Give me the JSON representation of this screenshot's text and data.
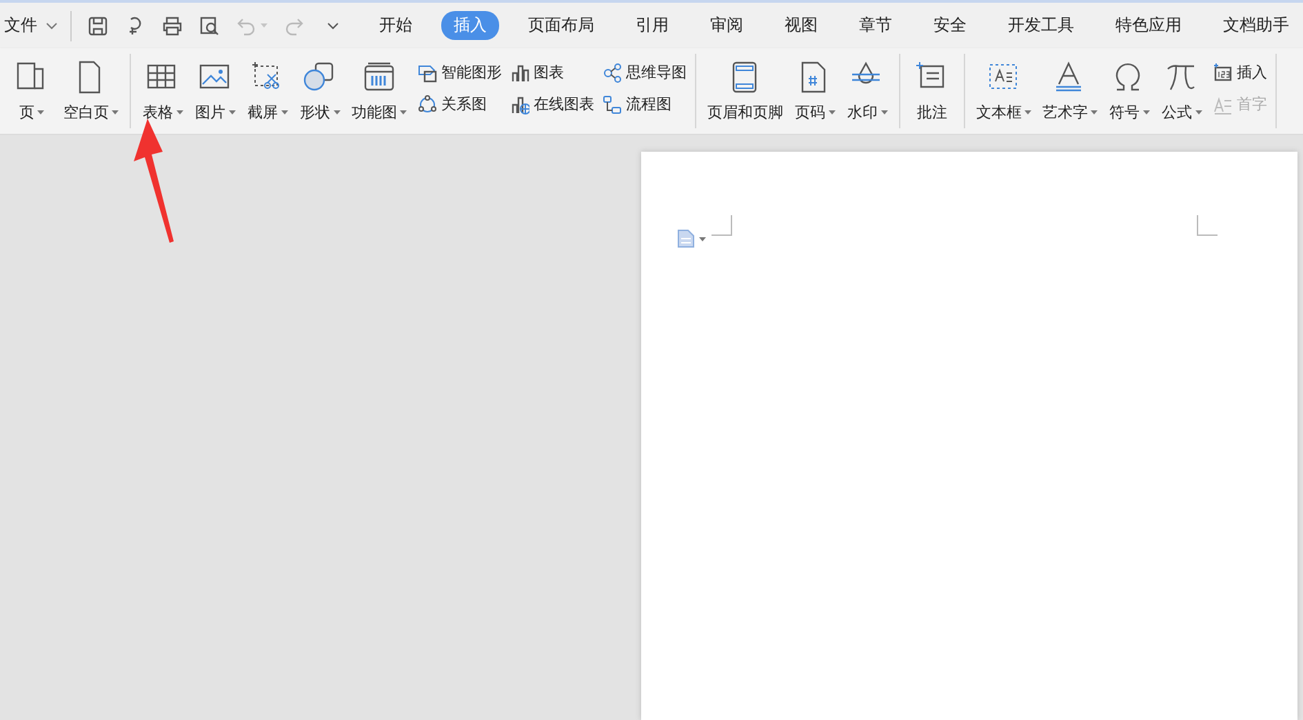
{
  "menu_bar": {
    "file_menu": "文件",
    "quick_access": [
      {
        "disabled": false
      },
      {
        "disabled": false
      },
      {
        "disabled": false
      },
      {
        "disabled": false
      },
      {
        "disabled": true
      },
      {
        "disabled": true
      }
    ],
    "tabs": [
      {
        "label": "开始",
        "selected": false
      },
      {
        "label": "插入",
        "selected": true
      },
      {
        "label": "页面布局",
        "selected": false
      },
      {
        "label": "引用",
        "selected": false
      },
      {
        "label": "审阅",
        "selected": false
      },
      {
        "label": "视图",
        "selected": false
      },
      {
        "label": "章节",
        "selected": false
      },
      {
        "label": "安全",
        "selected": false
      },
      {
        "label": "开发工具",
        "selected": false
      },
      {
        "label": "特色应用",
        "selected": false
      },
      {
        "label": "文档助手",
        "selected": false
      }
    ]
  },
  "ribbon": {
    "groups": [
      {
        "items": [
          {
            "kind": "big",
            "label": "页",
            "dropdown": true,
            "disabled": false
          },
          {
            "kind": "big",
            "label": "空白页",
            "dropdown": true,
            "disabled": false
          }
        ]
      },
      {
        "items": [
          {
            "kind": "big",
            "label": "表格",
            "dropdown": true,
            "disabled": false
          },
          {
            "kind": "big",
            "label": "图片",
            "dropdown": true,
            "disabled": false
          },
          {
            "kind": "big",
            "label": "截屏",
            "dropdown": true,
            "disabled": false
          },
          {
            "kind": "big",
            "label": "形状",
            "dropdown": true,
            "disabled": false
          },
          {
            "kind": "big",
            "label": "功能图",
            "dropdown": true,
            "disabled": false
          },
          {
            "kind": "small",
            "label": "智能图形",
            "dropdown": false,
            "disabled": false
          },
          {
            "kind": "small",
            "label": "关系图",
            "dropdown": false,
            "disabled": false
          },
          {
            "kind": "small",
            "label": "图表",
            "dropdown": false,
            "disabled": false
          },
          {
            "kind": "small",
            "label": "在线图表",
            "dropdown": false,
            "disabled": false
          },
          {
            "kind": "small",
            "label": "思维导图",
            "dropdown": false,
            "disabled": false
          },
          {
            "kind": "small",
            "label": "流程图",
            "dropdown": false,
            "disabled": false
          }
        ]
      },
      {
        "items": [
          {
            "kind": "big",
            "label": "页眉和页脚",
            "dropdown": false,
            "disabled": false
          },
          {
            "kind": "big",
            "label": "页码",
            "dropdown": true,
            "disabled": false
          },
          {
            "kind": "big",
            "label": "水印",
            "dropdown": true,
            "disabled": false
          }
        ]
      },
      {
        "items": [
          {
            "kind": "big",
            "label": "批注",
            "dropdown": false,
            "disabled": false
          }
        ]
      },
      {
        "items": [
          {
            "kind": "big",
            "label": "文本框",
            "dropdown": true,
            "disabled": false
          },
          {
            "kind": "big",
            "label": "艺术字",
            "dropdown": true,
            "disabled": false
          },
          {
            "kind": "big",
            "label": "符号",
            "dropdown": true,
            "disabled": false
          },
          {
            "kind": "big",
            "label": "公式",
            "dropdown": true,
            "disabled": false
          },
          {
            "kind": "small",
            "label": "插入",
            "dropdown": false,
            "disabled": false
          },
          {
            "kind": "small",
            "label": "首字",
            "dropdown": false,
            "disabled": true
          }
        ]
      }
    ]
  },
  "document": {
    "paste_options": {
      "dropdown": true
    }
  }
}
